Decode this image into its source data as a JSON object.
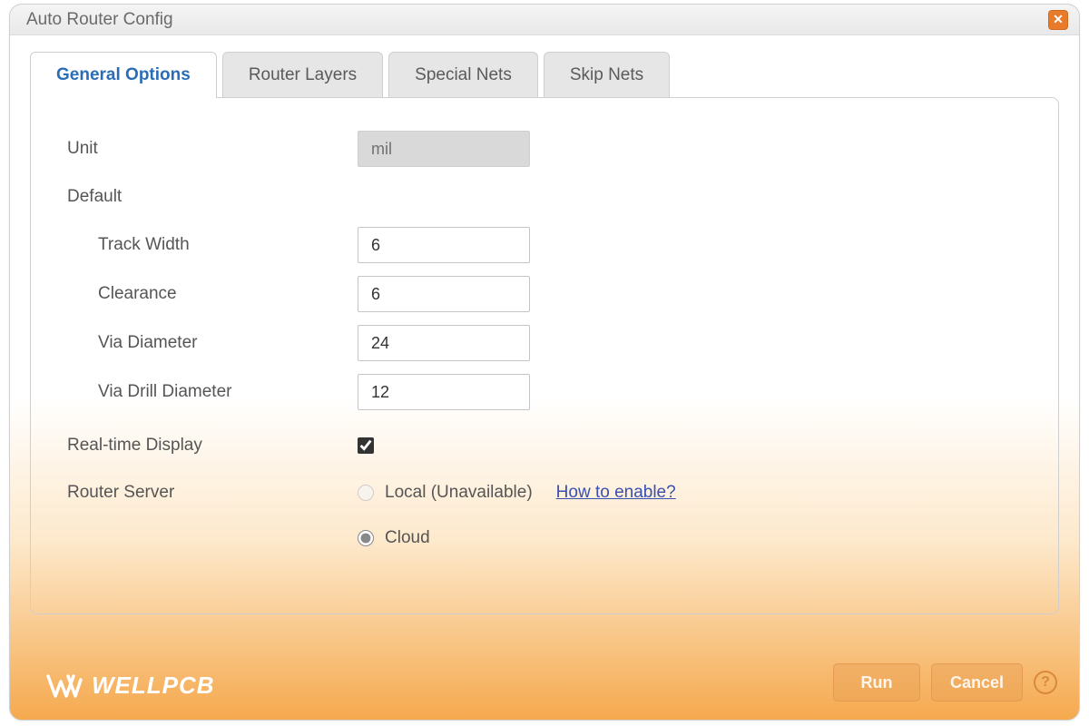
{
  "window": {
    "title": "Auto Router Config"
  },
  "tabs": [
    {
      "label": "General Options",
      "active": true
    },
    {
      "label": "Router Layers",
      "active": false
    },
    {
      "label": "Special Nets",
      "active": false
    },
    {
      "label": "Skip Nets",
      "active": false
    }
  ],
  "form": {
    "unit_label": "Unit",
    "unit_value": "mil",
    "default_label": "Default",
    "track_width_label": "Track Width",
    "track_width_value": "6",
    "clearance_label": "Clearance",
    "clearance_value": "6",
    "via_diameter_label": "Via Diameter",
    "via_diameter_value": "24",
    "via_drill_label": "Via Drill Diameter",
    "via_drill_value": "12",
    "realtime_label": "Real-time Display",
    "realtime_checked": true,
    "router_server_label": "Router Server",
    "server_local_label": "Local (Unavailable)",
    "server_local_link": "How to enable?",
    "server_cloud_label": "Cloud",
    "server_selected": "cloud"
  },
  "buttons": {
    "run": "Run",
    "cancel": "Cancel"
  },
  "watermark": "WELLPCB"
}
